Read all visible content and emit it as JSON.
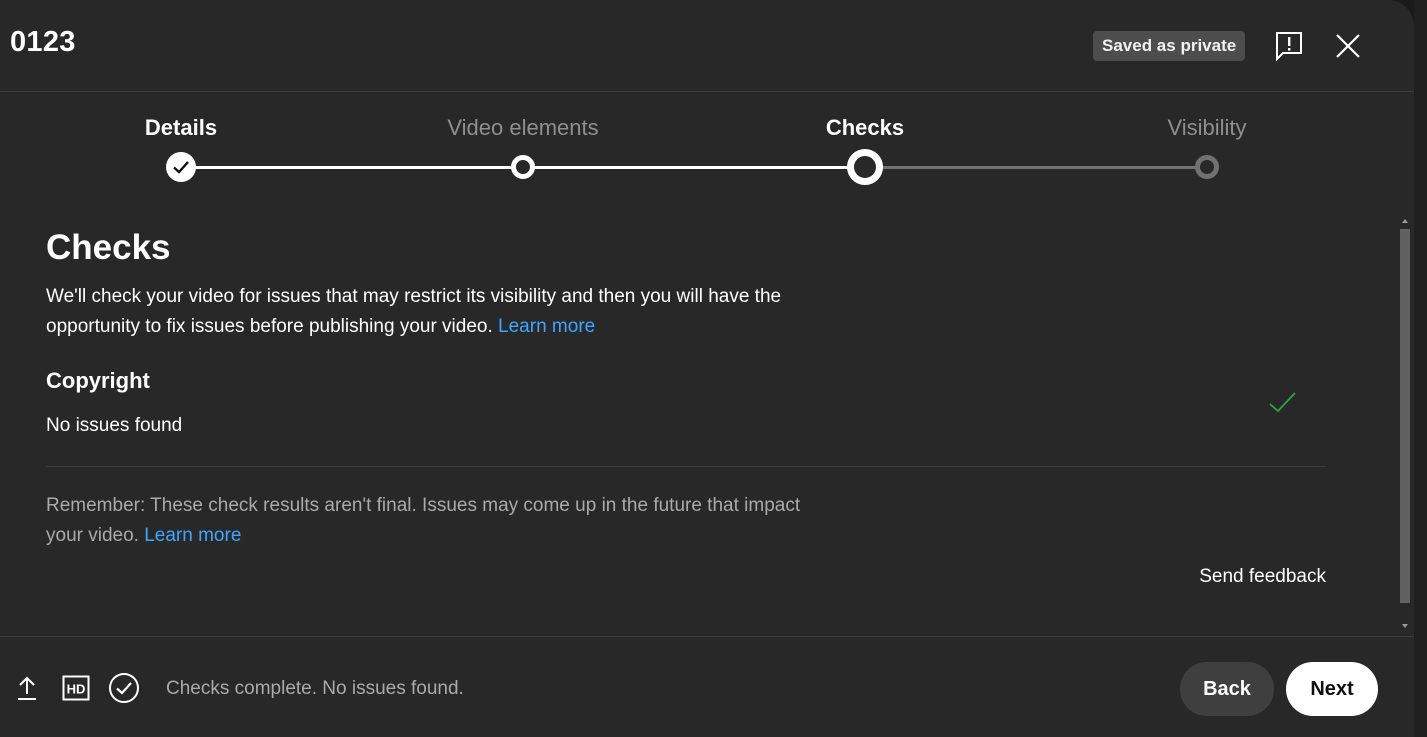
{
  "header": {
    "title": "0123",
    "saved_badge": "Saved as private"
  },
  "stepper": {
    "steps": [
      {
        "label": "Details",
        "state": "completed"
      },
      {
        "label": "Video elements",
        "state": "completed"
      },
      {
        "label": "Checks",
        "state": "current"
      },
      {
        "label": "Visibility",
        "state": "upcoming"
      }
    ]
  },
  "checks": {
    "title": "Checks",
    "intro": "We'll check your video for issues that may restrict its visibility and then you will have the opportunity to fix issues before publishing your video.",
    "intro_link": "Learn more",
    "copyright_title": "Copyright",
    "copyright_status": "No issues found",
    "remember": "Remember: These check results aren't final. Issues may come up in the future that impact your video.",
    "remember_link": "Learn more",
    "feedback": "Send feedback"
  },
  "footer": {
    "status": "Checks complete. No issues found.",
    "back_label": "Back",
    "next_label": "Next"
  },
  "colors": {
    "background": "#282828",
    "link": "#3ea6ff",
    "check_green": "#2ba640",
    "badge": "#4d4d4d"
  }
}
